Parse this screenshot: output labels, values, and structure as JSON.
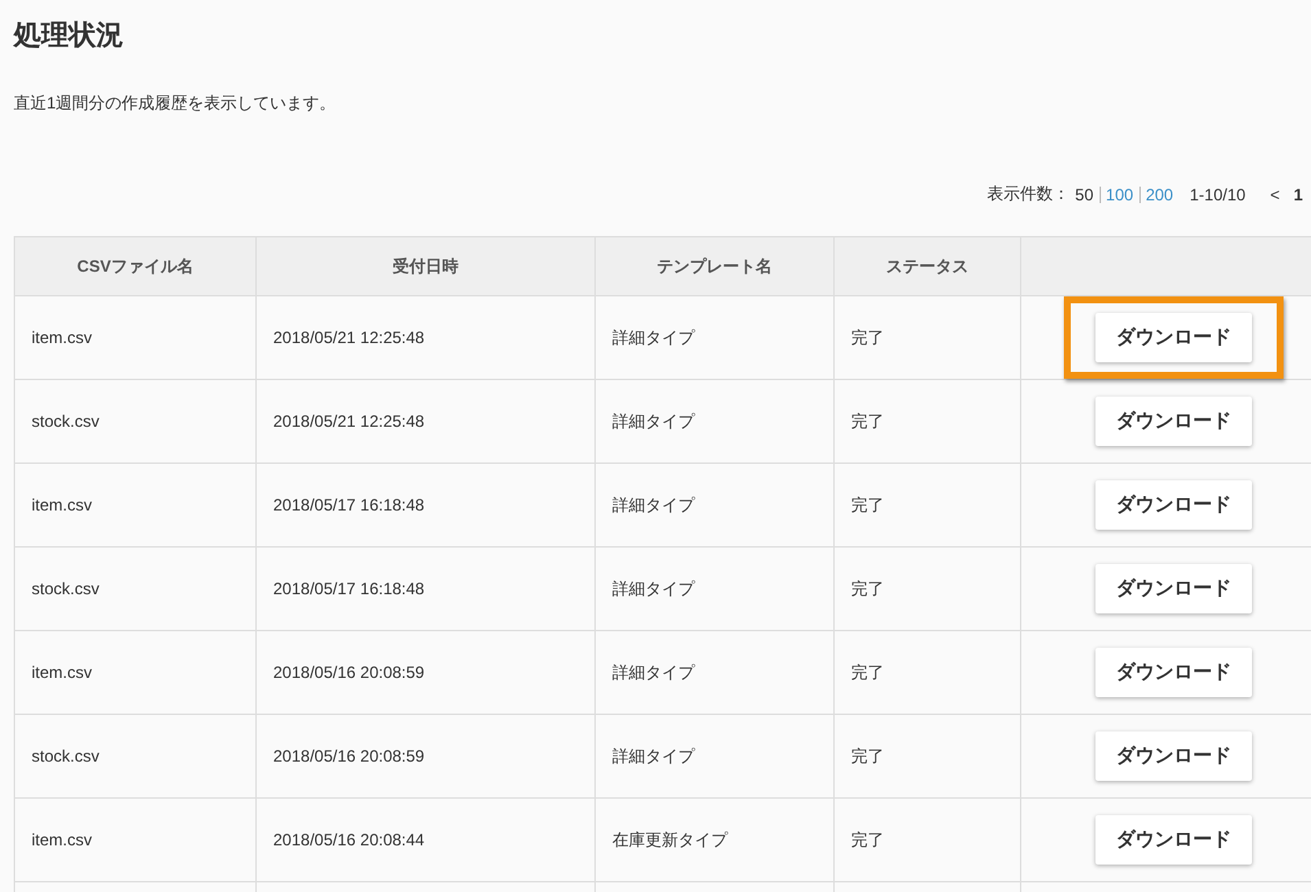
{
  "title": "処理状況",
  "description": "直近1週間分の作成履歴を表示しています。",
  "pager": {
    "label": "表示件数：",
    "sizes": [
      {
        "label": "50",
        "selected": true
      },
      {
        "label": "100",
        "selected": false
      },
      {
        "label": "200",
        "selected": false
      }
    ],
    "range": "1-10/10",
    "prev": "<",
    "page": "1"
  },
  "table": {
    "columns": [
      "CSVファイル名",
      "受付日時",
      "テンプレート名",
      "ステータス"
    ],
    "rows": [
      {
        "file": "item.csv",
        "date": "2018/05/21 12:25:48",
        "template": "詳細タイプ",
        "status": "完了",
        "action": "ダウンロード",
        "highlighted": true
      },
      {
        "file": "stock.csv",
        "date": "2018/05/21 12:25:48",
        "template": "詳細タイプ",
        "status": "完了",
        "action": "ダウンロード",
        "highlighted": false
      },
      {
        "file": "item.csv",
        "date": "2018/05/17 16:18:48",
        "template": "詳細タイプ",
        "status": "完了",
        "action": "ダウンロード",
        "highlighted": false
      },
      {
        "file": "stock.csv",
        "date": "2018/05/17 16:18:48",
        "template": "詳細タイプ",
        "status": "完了",
        "action": "ダウンロード",
        "highlighted": false
      },
      {
        "file": "item.csv",
        "date": "2018/05/16 20:08:59",
        "template": "詳細タイプ",
        "status": "完了",
        "action": "ダウンロード",
        "highlighted": false
      },
      {
        "file": "stock.csv",
        "date": "2018/05/16 20:08:59",
        "template": "詳細タイプ",
        "status": "完了",
        "action": "ダウンロード",
        "highlighted": false
      },
      {
        "file": "item.csv",
        "date": "2018/05/16 20:08:44",
        "template": "在庫更新タイプ",
        "status": "完了",
        "action": "ダウンロード",
        "highlighted": false
      }
    ]
  }
}
